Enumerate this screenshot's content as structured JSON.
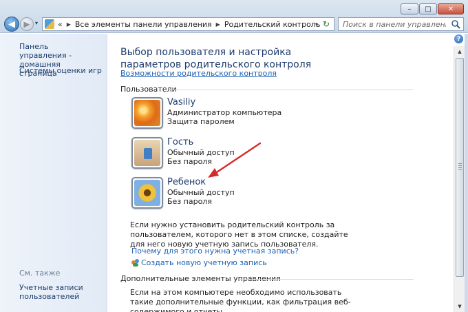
{
  "window": {
    "minimize_glyph": "–",
    "maximize_glyph": "□",
    "close_glyph": "✕"
  },
  "nav": {
    "back_glyph": "◀",
    "forward_glyph": "▶",
    "dropdown_glyph": "▾"
  },
  "address": {
    "overflow": "«",
    "crumbs": [
      "Все элементы панели управления",
      "Родительский контроль"
    ],
    "separator": "▶",
    "dropdown_glyph": "▾",
    "refresh_glyph": "↻"
  },
  "search": {
    "placeholder": "Поиск в панели управления"
  },
  "sidebar": {
    "home_link": "Панель управления - домашняя страница",
    "ratings_link": "Системы оценки игр",
    "see_also": "См. также",
    "user_accounts_link": "Учетные записи пользователей"
  },
  "main": {
    "title": "Выбор пользователя и настройка параметров родительского контроля",
    "features_link": "Возможности родительского контроля",
    "users_header": "Пользователи",
    "accounts": [
      {
        "name": "Vasiliy",
        "type": "Администратор компьютера",
        "password": "Защита паролем",
        "avatar": "flower"
      },
      {
        "name": "Гость",
        "type": "Обычный доступ",
        "password": "Без пароля",
        "avatar": "guest"
      },
      {
        "name": "Ребенок",
        "type": "Обычный доступ",
        "password": "Без пароля",
        "avatar": "sunflower"
      }
    ],
    "info_text": "Если нужно установить родительский контроль за пользователем, которого нет в этом списке, создайте для него новую учетную запись пользователя.",
    "why_link": "Почему для этого нужна учетная запись?",
    "create_link": "Создать новую учетную запись",
    "extra_header": "Дополнительные элементы управления",
    "extra_text": "Если на этом компьютере необходимо использовать такие дополнительные функции, как фильтрация веб-содержимого и отчеты"
  },
  "help_glyph": "?",
  "scroll": {
    "up_glyph": "▲",
    "down_glyph": "▼"
  },
  "colors": {
    "link": "#1a5fb4",
    "title": "#1e3b6e",
    "arrow": "#d42a2a"
  }
}
